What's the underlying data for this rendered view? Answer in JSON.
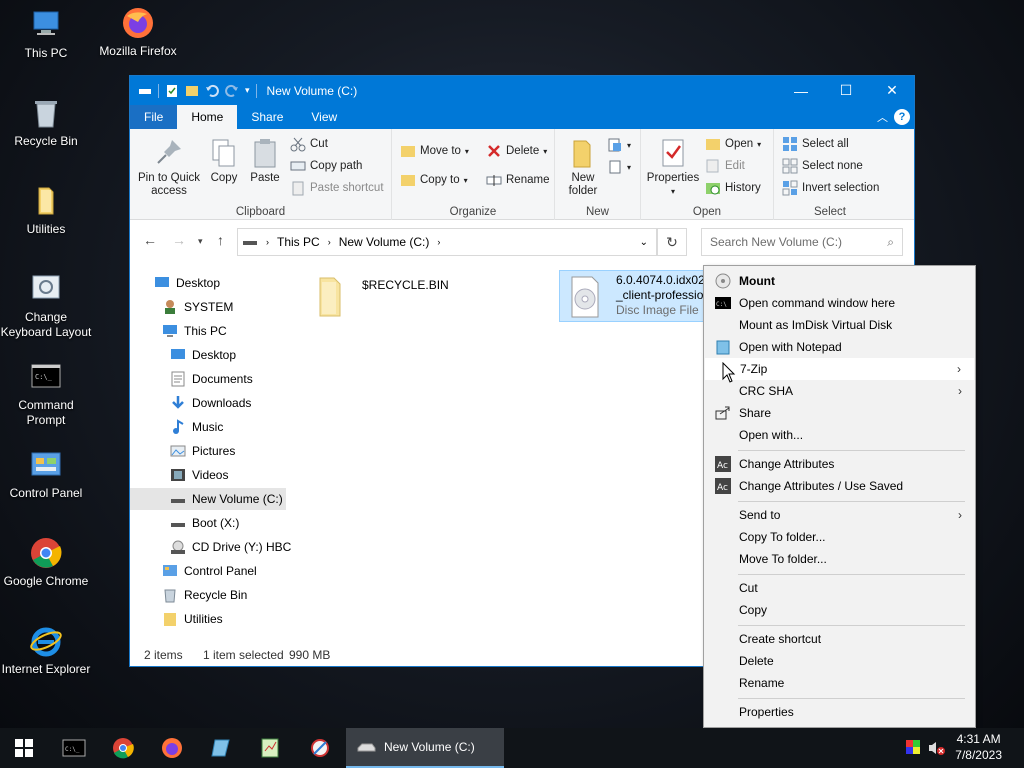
{
  "desktop": {
    "icons": [
      {
        "label": "This PC",
        "icon": "pc-icon"
      },
      {
        "label": "Mozilla Firefox",
        "icon": "firefox-icon"
      },
      {
        "label": "Recycle Bin",
        "icon": "recycle-bin-icon"
      },
      {
        "label": "Utilities",
        "icon": "folder-icon"
      },
      {
        "label": "Change Keyboard Layout",
        "icon": "keyboard-settings-icon"
      },
      {
        "label": "Command Prompt",
        "icon": "cmd-icon"
      },
      {
        "label": "Control Panel",
        "icon": "control-panel-icon"
      },
      {
        "label": "Google Chrome",
        "icon": "chrome-icon"
      },
      {
        "label": "Internet Explorer",
        "icon": "ie-icon"
      }
    ]
  },
  "window": {
    "title": "New Volume (C:)",
    "controls": {
      "minimize": "—",
      "maximize": "☐",
      "close": "✕"
    }
  },
  "ribbon": {
    "tabs": [
      "File",
      "Home",
      "Share",
      "View"
    ],
    "active_tab": "Home",
    "clipboard": {
      "pin": "Pin to Quick access",
      "copy": "Copy",
      "paste": "Paste",
      "cut": "Cut",
      "copy_path": "Copy path",
      "paste_shortcut": "Paste shortcut",
      "label": "Clipboard"
    },
    "organize": {
      "move_to": "Move to",
      "copy_to": "Copy to",
      "delete": "Delete",
      "rename": "Rename",
      "label": "Organize"
    },
    "new": {
      "new_folder": "New folder",
      "label": "New"
    },
    "open": {
      "properties": "Properties",
      "open": "Open",
      "edit": "Edit",
      "history": "History",
      "label": "Open"
    },
    "select": {
      "select_all": "Select all",
      "select_none": "Select none",
      "invert": "Invert selection",
      "label": "Select"
    }
  },
  "address": {
    "path": [
      "This PC",
      "New Volume (C:)"
    ],
    "search_placeholder": "Search New Volume (C:)"
  },
  "nav": [
    {
      "label": "Desktop",
      "icon": "desktop-icon"
    },
    {
      "label": "SYSTEM",
      "icon": "user-icon"
    },
    {
      "label": "This PC",
      "icon": "pc-icon"
    },
    {
      "label": "Desktop",
      "icon": "desktop-icon"
    },
    {
      "label": "Documents",
      "icon": "documents-icon"
    },
    {
      "label": "Downloads",
      "icon": "downloads-icon"
    },
    {
      "label": "Music",
      "icon": "music-icon"
    },
    {
      "label": "Pictures",
      "icon": "pictures-icon"
    },
    {
      "label": "Videos",
      "icon": "videos-icon"
    },
    {
      "label": "New Volume (C:)",
      "icon": "drive-icon"
    },
    {
      "label": "Boot (X:)",
      "icon": "drive-icon"
    },
    {
      "label": "CD Drive (Y:) HBC",
      "icon": "cd-drive-icon"
    },
    {
      "label": "Control Panel",
      "icon": "control-panel-icon"
    },
    {
      "label": "Recycle Bin",
      "icon": "recycle-bin-icon"
    },
    {
      "label": "Utilities",
      "icon": "folder-icon"
    }
  ],
  "files": [
    {
      "name": "$RECYCLE.BIN",
      "type": ""
    },
    {
      "name_line1": "6.0.4074.0.idx02.0",
      "name_line2": "_client-professio",
      "type": "Disc Image File"
    }
  ],
  "status": {
    "items": "2 items",
    "selected": "1 item selected",
    "size": "990 MB"
  },
  "context_menu": {
    "items": [
      {
        "label": "Mount",
        "bold": true,
        "icon": "disc-icon"
      },
      {
        "label": "Open command window here",
        "icon": "cmd-icon"
      },
      {
        "label": "Mount as ImDisk Virtual Disk",
        "icon": ""
      },
      {
        "label": "Open with Notepad",
        "icon": "notepad-icon"
      },
      {
        "label": "7-Zip",
        "submenu": true
      },
      {
        "label": "CRC SHA",
        "submenu": true
      },
      {
        "label": "Share",
        "icon": "share-icon"
      },
      {
        "label": "Open with..."
      },
      {
        "label": "Change Attributes",
        "icon": "attributes-icon"
      },
      {
        "label": "Change Attributes / Use Saved",
        "icon": "attributes-icon"
      },
      {
        "label": "Send to",
        "submenu": true
      },
      {
        "label": "Copy To folder..."
      },
      {
        "label": "Move To folder..."
      },
      {
        "label": "Cut"
      },
      {
        "label": "Copy"
      },
      {
        "label": "Create shortcut"
      },
      {
        "label": "Delete"
      },
      {
        "label": "Rename"
      },
      {
        "label": "Properties"
      }
    ]
  },
  "taskbar": {
    "window_label": "New Volume (C:)",
    "time": "4:31 AM",
    "date": "7/8/2023"
  },
  "colors": {
    "titlebar": "#0078d7",
    "taskbar": "#101418",
    "selection": "#cce8ff"
  }
}
